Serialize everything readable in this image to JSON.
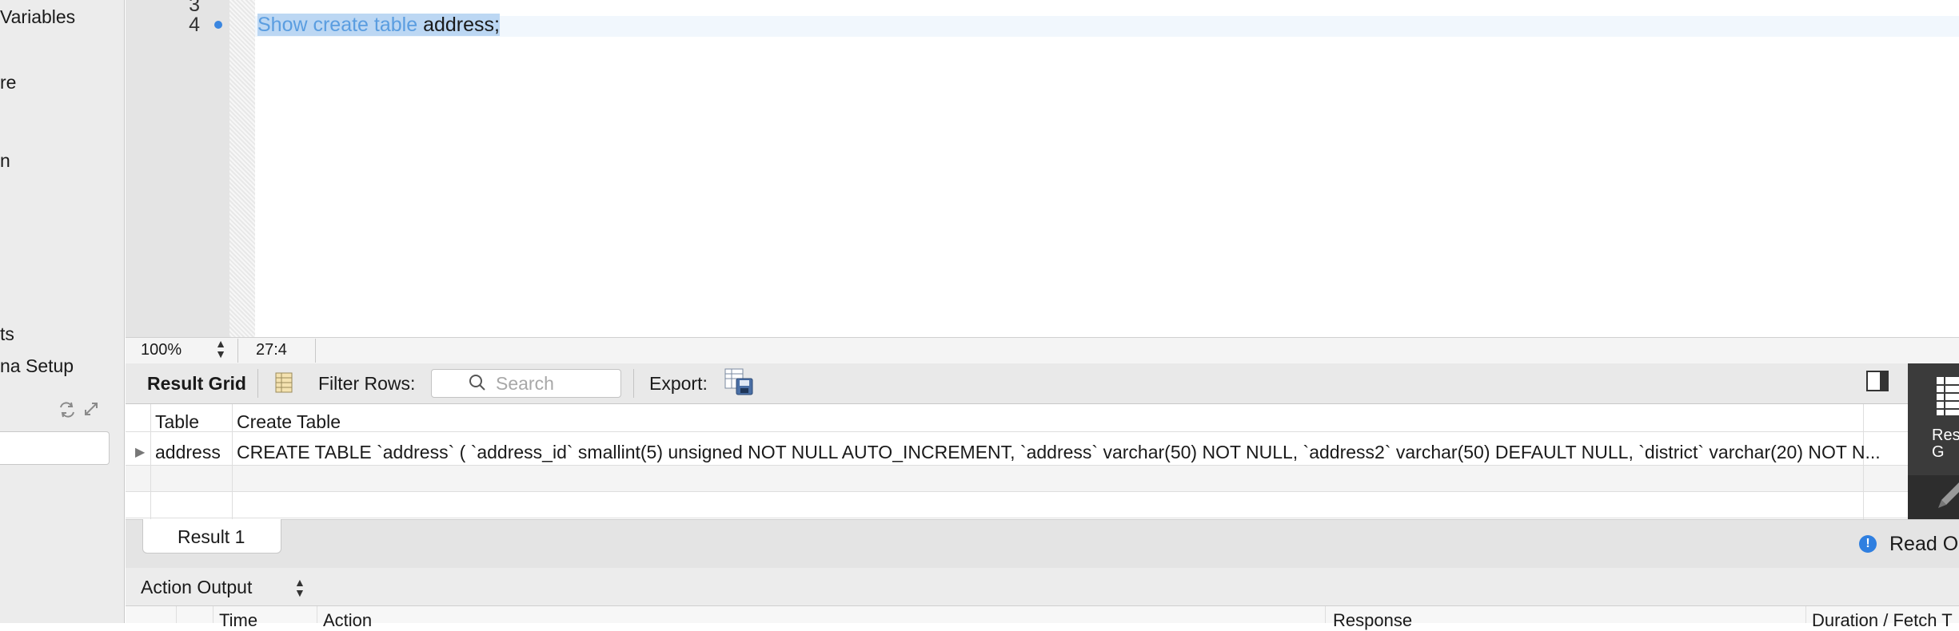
{
  "sidebar": {
    "items": [
      {
        "label": "Variables"
      },
      {
        "label": "re"
      },
      {
        "label": "n"
      },
      {
        "label": "ts"
      },
      {
        "label": "na Setup"
      }
    ]
  },
  "editor": {
    "line_numbers": [
      "3",
      "4"
    ],
    "code_keyword": "Show create table",
    "code_rest": " address;",
    "zoom": "100%",
    "cursor_position": "27:4"
  },
  "result_toolbar": {
    "result_grid_label": "Result Grid",
    "filter_label": "Filter Rows:",
    "search_placeholder": "Search",
    "export_label": "Export:"
  },
  "grid": {
    "columns": [
      "Table",
      "Create Table"
    ],
    "rows": [
      [
        "address",
        "CREATE TABLE `address` (   `address_id` smallint(5) unsigned NOT NULL AUTO_INCREMENT,   `address` varchar(50) NOT NULL,   `address2` varchar(50) DEFAULT NULL,   `district` varchar(20) NOT N..."
      ]
    ]
  },
  "side_panel": {
    "label_line1": "Res",
    "label_line2": "G"
  },
  "tabs": {
    "result_tab": "Result 1",
    "read_only": "Read On"
  },
  "action_output": {
    "label": "Action Output",
    "columns": [
      "Time",
      "Action",
      "Response",
      "Duration / Fetch T"
    ]
  }
}
